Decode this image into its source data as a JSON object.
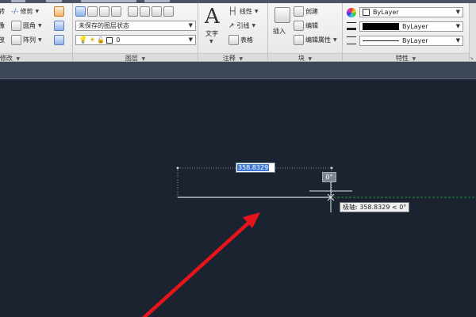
{
  "ribbon": {
    "modify": {
      "title": "修改",
      "items": {
        "rotate_fragment": "转",
        "trim": "修剪",
        "mirror_fragment": "像",
        "fillet": "圆角",
        "scale_fragment": "放",
        "array": "阵列"
      }
    },
    "layers": {
      "title": "图层",
      "layer_state": "未保存的图层状态",
      "current_layer": "0"
    },
    "annotation": {
      "title": "注释",
      "text": "文字",
      "linear": "线性",
      "leader": "引线",
      "table": "表格"
    },
    "block": {
      "title": "块",
      "insert": "插入",
      "create": "创建",
      "edit": "编辑",
      "edit_attributes": "编辑属性"
    },
    "properties": {
      "title": "特性",
      "color": "ByLayer",
      "lineweight": "ByLayer",
      "linetype": "ByLayer"
    }
  },
  "canvas": {
    "distance_input": "358.8329",
    "angle_input": "0°",
    "polar_tooltip": "极轴: 358.8329 < 0°"
  },
  "colors": {
    "canvas_bg": "#1b2330",
    "selection": "#3b78d8",
    "arrow": "#e8141b",
    "tracking_line": "#1f8f3a"
  }
}
